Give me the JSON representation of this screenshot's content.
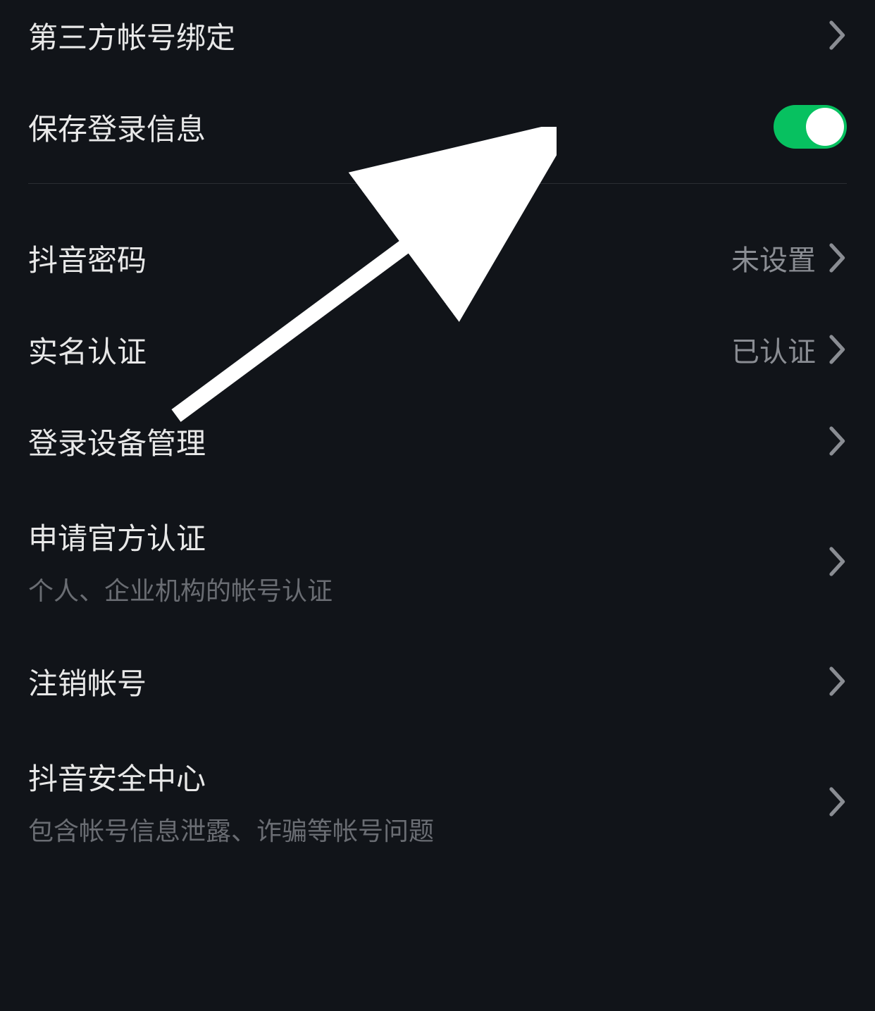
{
  "items": {
    "third_party": {
      "label": "第三方帐号绑定"
    },
    "save_login": {
      "label": "保存登录信息",
      "toggle_on": true
    },
    "password": {
      "label": "抖音密码",
      "value": "未设置"
    },
    "real_name": {
      "label": "实名认证",
      "value": "已认证"
    },
    "device_mgmt": {
      "label": "登录设备管理"
    },
    "official_verify": {
      "label": "申请官方认证",
      "sublabel": "个人、企业机构的帐号认证"
    },
    "delete_account": {
      "label": "注销帐号"
    },
    "security_center": {
      "label": "抖音安全中心",
      "sublabel": "包含帐号信息泄露、诈骗等帐号问题"
    }
  }
}
